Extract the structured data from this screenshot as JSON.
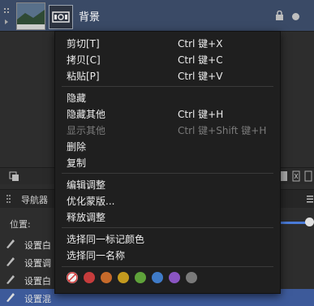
{
  "layer": {
    "name": "背景"
  },
  "panels": {
    "navigator_tab": "导航器",
    "position_label": "位置:",
    "history": [
      "设置白",
      "设置调",
      "设置白",
      "设置混"
    ]
  },
  "menu": {
    "items": [
      {
        "label": "剪切[T]",
        "shortcut": "Ctrl 键+X"
      },
      {
        "label": "拷贝[C]",
        "shortcut": "Ctrl 键+C"
      },
      {
        "label": "粘贴[P]",
        "shortcut": "Ctrl 键+V"
      },
      {
        "label": "隐藏",
        "shortcut": ""
      },
      {
        "label": "隐藏其他",
        "shortcut": "Ctrl 键+H"
      },
      {
        "label": "显示其他",
        "shortcut": "Ctrl 键+Shift 键+H"
      },
      {
        "label": "删除",
        "shortcut": ""
      },
      {
        "label": "复制",
        "shortcut": ""
      },
      {
        "label": "编辑调整",
        "shortcut": ""
      },
      {
        "label": "优化蒙版...",
        "shortcut": ""
      },
      {
        "label": "释放调整",
        "shortcut": ""
      },
      {
        "label": "选择同一标记颜色",
        "shortcut": ""
      },
      {
        "label": "选择同一名称",
        "shortcut": ""
      }
    ],
    "tag_colors": [
      "none",
      "#c63c3c",
      "#c66a2a",
      "#c49a1e",
      "#5fa23a",
      "#3f7bc8",
      "#8a55c2",
      "#7a7a7a"
    ]
  }
}
